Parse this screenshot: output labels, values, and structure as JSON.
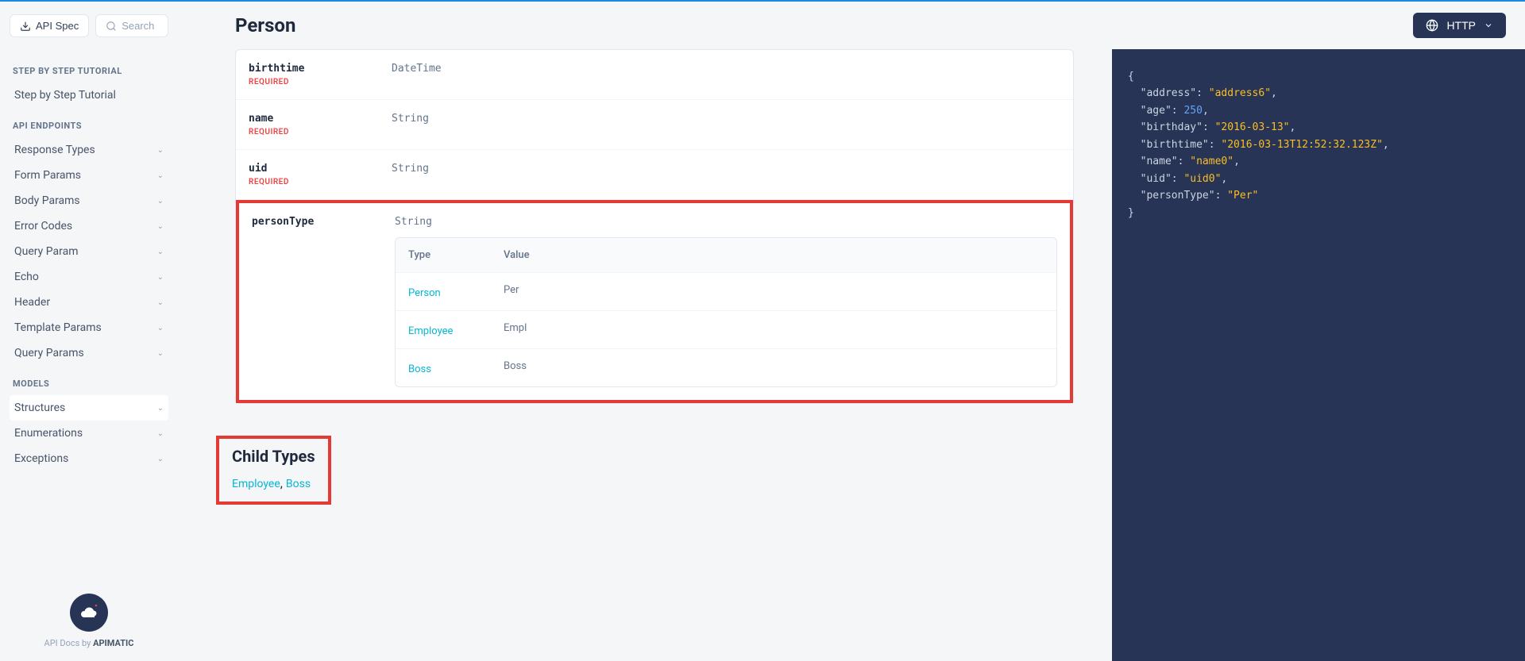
{
  "header": {
    "api_spec_label": "API Spec",
    "search_placeholder": "Search",
    "title": "Person",
    "selector_label": "HTTP"
  },
  "sidebar": {
    "sections": {
      "tutorial": {
        "title": "STEP BY STEP TUTORIAL",
        "items": [
          "Step by Step Tutorial"
        ]
      },
      "endpoints": {
        "title": "API ENDPOINTS",
        "items": [
          "Response Types",
          "Form Params",
          "Body Params",
          "Error Codes",
          "Query Param",
          "Echo",
          "Header",
          "Template Params",
          "Query Params"
        ]
      },
      "models": {
        "title": "MODELS",
        "items": [
          "Structures",
          "Enumerations",
          "Exceptions"
        ]
      }
    },
    "footer_prefix": "API Docs by ",
    "footer_brand": "APIMATIC"
  },
  "fields": [
    {
      "name": "birthtime",
      "type": "DateTime",
      "required": true
    },
    {
      "name": "name",
      "type": "String",
      "required": true
    },
    {
      "name": "uid",
      "type": "String",
      "required": true
    },
    {
      "name": "personType",
      "type": "String",
      "required": false
    }
  ],
  "required_label": "REQUIRED",
  "discriminator_table": {
    "headers": {
      "type": "Type",
      "value": "Value"
    },
    "rows": [
      {
        "type": "Person",
        "value": "Per"
      },
      {
        "type": "Employee",
        "value": "Empl"
      },
      {
        "type": "Boss",
        "value": "Boss"
      }
    ]
  },
  "child_types": {
    "heading": "Child Types",
    "links": [
      "Employee",
      "Boss"
    ],
    "sep": ", "
  },
  "code_sample": {
    "address": "address6",
    "age": 250,
    "birthday": "2016-03-13",
    "birthtime": "2016-03-13T12:52:32.123Z",
    "name": "name0",
    "uid": "uid0",
    "personType": "Per"
  }
}
